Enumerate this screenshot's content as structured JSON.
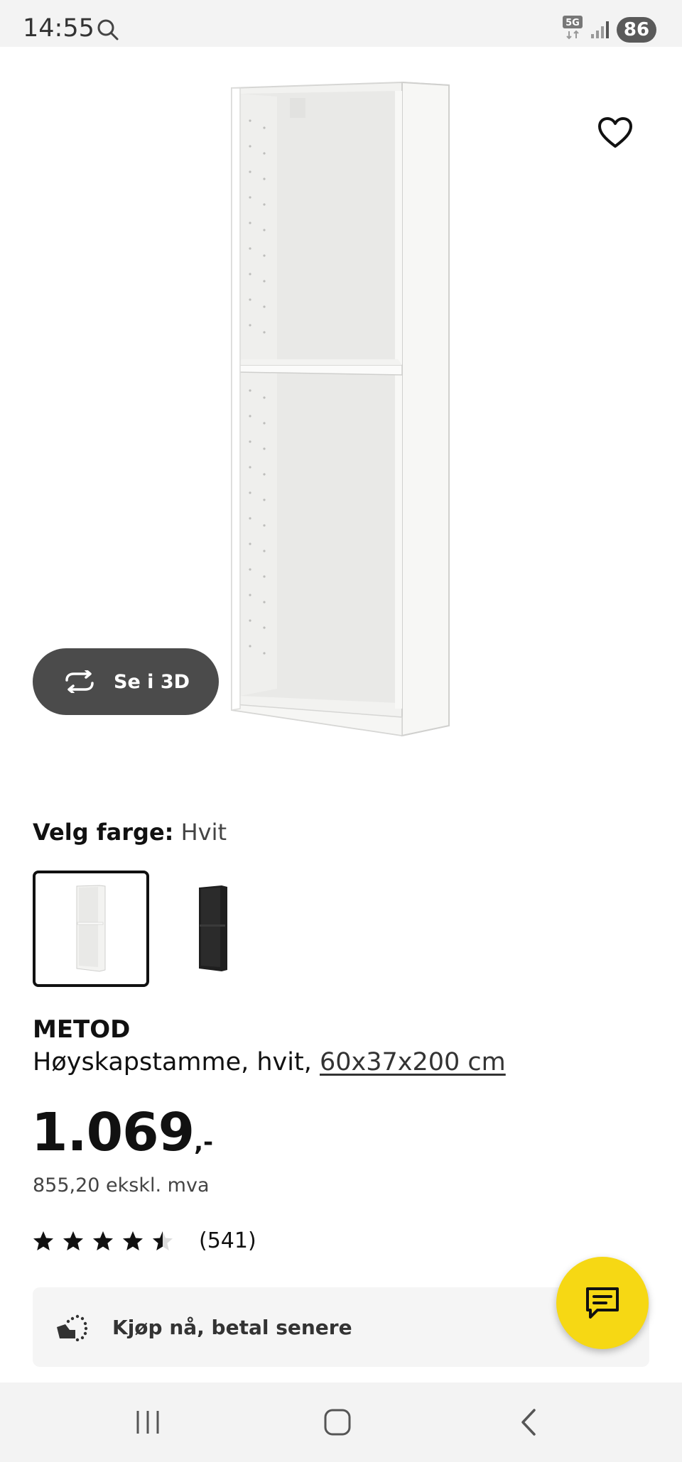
{
  "status_bar": {
    "time": "14:55",
    "network": "5G",
    "battery": "86"
  },
  "product_view": {
    "see_3d_label": "Se i 3D"
  },
  "color_selector": {
    "label": "Velg farge:",
    "selected_value": "Hvit",
    "options": [
      "white",
      "black"
    ]
  },
  "product": {
    "name": "METOD",
    "description": "Høyskapstamme, hvit,",
    "dimensions": "60x37x200 cm",
    "price": "1.069",
    "price_suffix": ",-",
    "price_excl_vat": "855,20 ekskl. mva",
    "rating_value": 4.5,
    "rating_count": "(541)"
  },
  "pay_later": {
    "label": "Kjøp nå, betal senere"
  },
  "colors": {
    "chat_fab": "#f6d814",
    "see_3d_bg": "#4b4b4b"
  }
}
